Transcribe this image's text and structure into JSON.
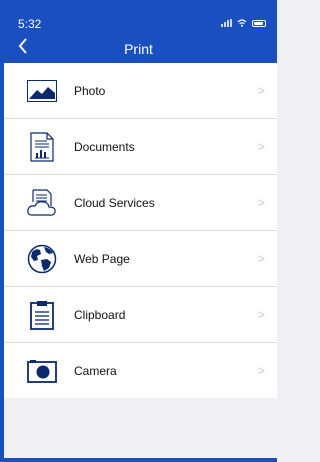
{
  "status": {
    "time": "5:32"
  },
  "nav": {
    "title": "Print"
  },
  "items": [
    {
      "label": "Photo",
      "icon": "photo-icon"
    },
    {
      "label": "Documents",
      "icon": "document-icon"
    },
    {
      "label": "Cloud Services",
      "icon": "cloud-services-icon"
    },
    {
      "label": "Web Page",
      "icon": "globe-icon"
    },
    {
      "label": "Clipboard",
      "icon": "clipboard-icon"
    },
    {
      "label": "Camera",
      "icon": "camera-icon"
    }
  ],
  "colors": {
    "accent": "#1a4fbf",
    "icon": "#0b2a6e",
    "background": "#efeff4"
  }
}
